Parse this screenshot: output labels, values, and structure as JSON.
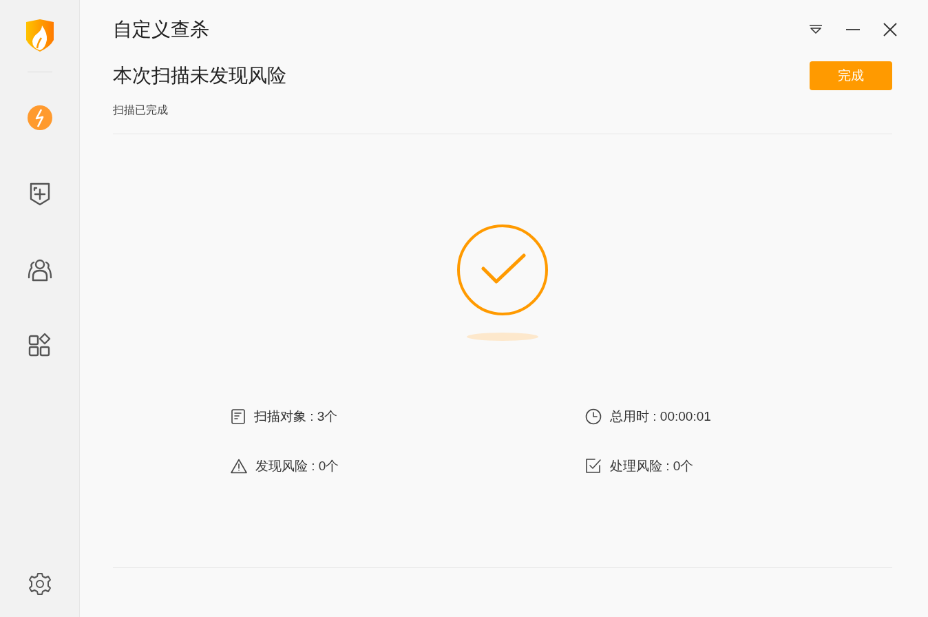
{
  "window": {
    "title": "自定义查杀"
  },
  "sidebar": {
    "items": [
      {
        "kind": "bolt",
        "selected": true
      },
      {
        "kind": "shield-plus",
        "selected": false
      },
      {
        "kind": "users",
        "selected": false
      },
      {
        "kind": "apps",
        "selected": false
      }
    ]
  },
  "header": {
    "heading": "本次扫描未发现风险",
    "status": "扫描已完成",
    "done_button": "完成"
  },
  "stats": [
    {
      "kind": "document",
      "text": "扫描对象 : 3个"
    },
    {
      "kind": "clock",
      "text": "总用时 : 00:00:01"
    },
    {
      "kind": "warning",
      "text": "发现风险 : 0个"
    },
    {
      "kind": "checkbox",
      "text": "处理风险 : 0个"
    }
  ]
}
